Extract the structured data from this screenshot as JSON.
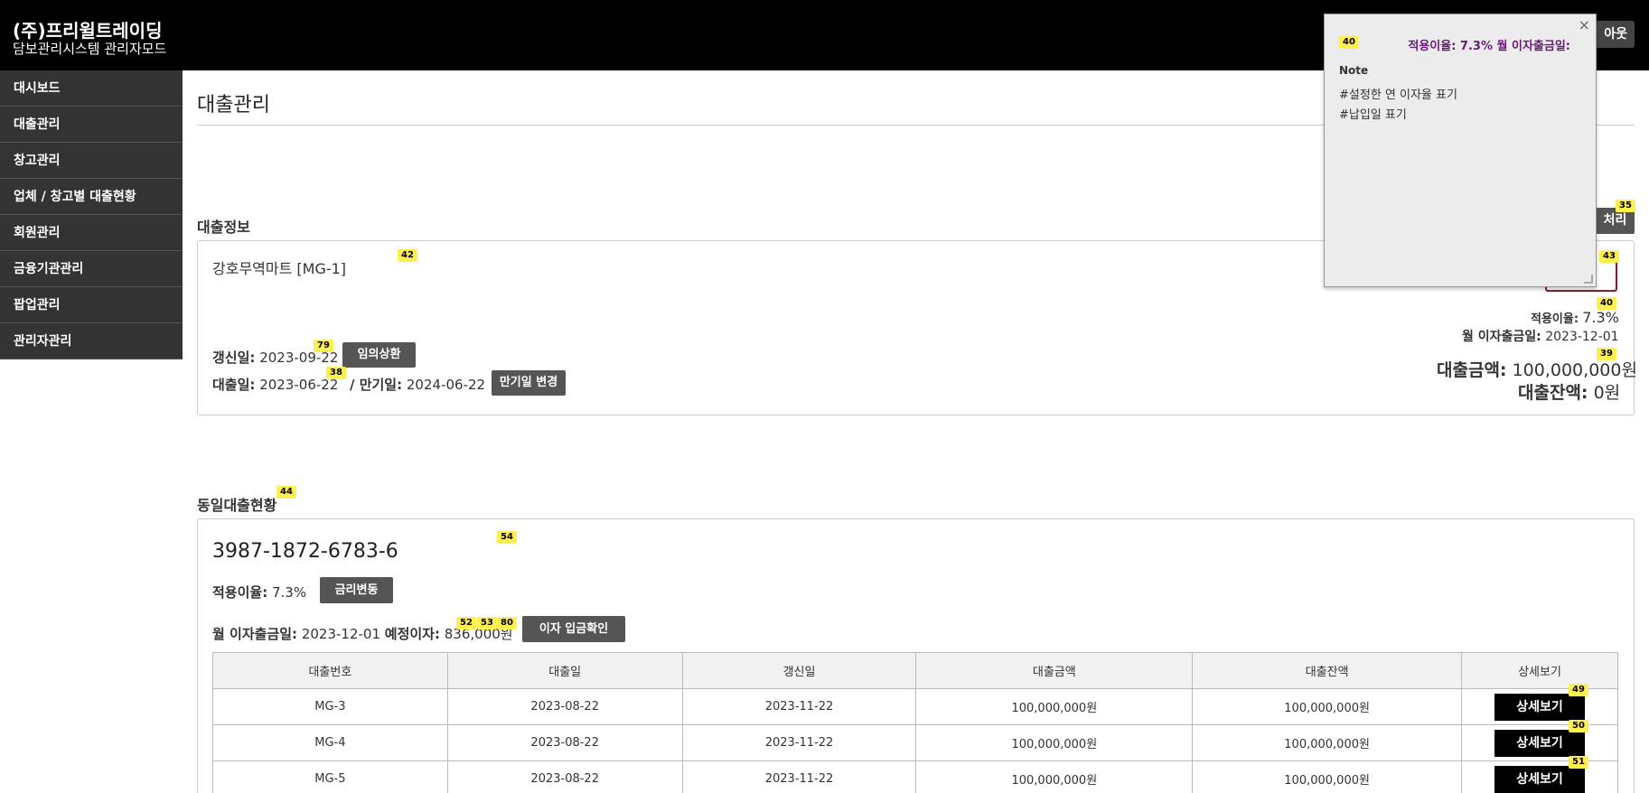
{
  "header": {
    "brand_name": "(주)프리윌트레이딩",
    "brand_sub": "담보관리시스템 관리자모드",
    "logout_label": "아웃"
  },
  "sidebar": {
    "items": [
      {
        "label": "대시보드"
      },
      {
        "label": "대출관리"
      },
      {
        "label": "창고관리"
      },
      {
        "label": "업체 / 창고별 대출현황"
      },
      {
        "label": "회원관리"
      },
      {
        "label": "금융기관관리"
      },
      {
        "label": "팝업관리"
      },
      {
        "label": "관리자관리"
      }
    ]
  },
  "page": {
    "title": "대출관리"
  },
  "loan_info": {
    "section_label": "대출정보",
    "process_button": "처리",
    "company": "강호무역마트 [MG-1]",
    "renewal_label": "갱신일:",
    "renewal_date": "2023-09-22",
    "repay_button": "임의상환",
    "loan_date_label": "대출일:",
    "loan_date": "2023-06-22",
    "maturity_label": "/ 만기일:",
    "maturity_date": "2024-06-22",
    "maturity_button": "만기일 변경",
    "rate_label": "적용이율:",
    "rate_value": "7.3%",
    "interest_date_label": "월 이자출금일:",
    "interest_date": "2023-12-01",
    "amount_label": "대출금액:",
    "amount_value": "100,000,000원",
    "balance_label": "대출잔액:",
    "balance_value": "0원"
  },
  "same_loans": {
    "section_label": "동일대출현황",
    "account": "3987-1872-6783-6",
    "rate_label": "적용이율:",
    "rate_value": "7.3%",
    "rate_button": "금리변동",
    "interest_date_label": "월 이자출금일:",
    "interest_date": "2023-12-01",
    "expected_label": "예정이자:",
    "expected_value": "836,000원",
    "interest_confirm_button": "이자 입금확인",
    "columns": [
      "대출번호",
      "대출일",
      "갱신일",
      "대출금액",
      "대출잔액",
      "상세보기"
    ],
    "rows": [
      {
        "no": "MG-3",
        "loan_date": "2023-08-22",
        "renewal": "2023-11-22",
        "amount": "100,000,000원",
        "balance": "100,000,000원",
        "detail": "상세보기"
      },
      {
        "no": "MG-4",
        "loan_date": "2023-08-22",
        "renewal": "2023-11-22",
        "amount": "100,000,000원",
        "balance": "100,000,000원",
        "detail": "상세보기"
      },
      {
        "no": "MG-5",
        "loan_date": "2023-08-22",
        "renewal": "2023-11-22",
        "amount": "100,000,000원",
        "balance": "100,000,000원",
        "detail": "상세보기"
      }
    ]
  },
  "note_popup": {
    "badge": "40",
    "heading": "적용이율: 7.3% 월 이자출금일:",
    "title": "Note",
    "lines": [
      "#설정한 연 이자율 표기",
      "#납입일 표기"
    ],
    "close": "×"
  },
  "badges": {
    "b35": "35",
    "b42": "42",
    "b43": "43",
    "b40": "40",
    "b79": "79",
    "b38": "38",
    "b39": "39",
    "b44": "44",
    "b54": "54",
    "b52": "52",
    "b53": "53",
    "b80": "80",
    "b49": "49",
    "b50": "50",
    "b51": "51"
  },
  "colors": {
    "header_bg": "#000000",
    "sidebar_bg": "#333333",
    "note_accent": "#6a1b7a",
    "badge": "#ffef50"
  }
}
